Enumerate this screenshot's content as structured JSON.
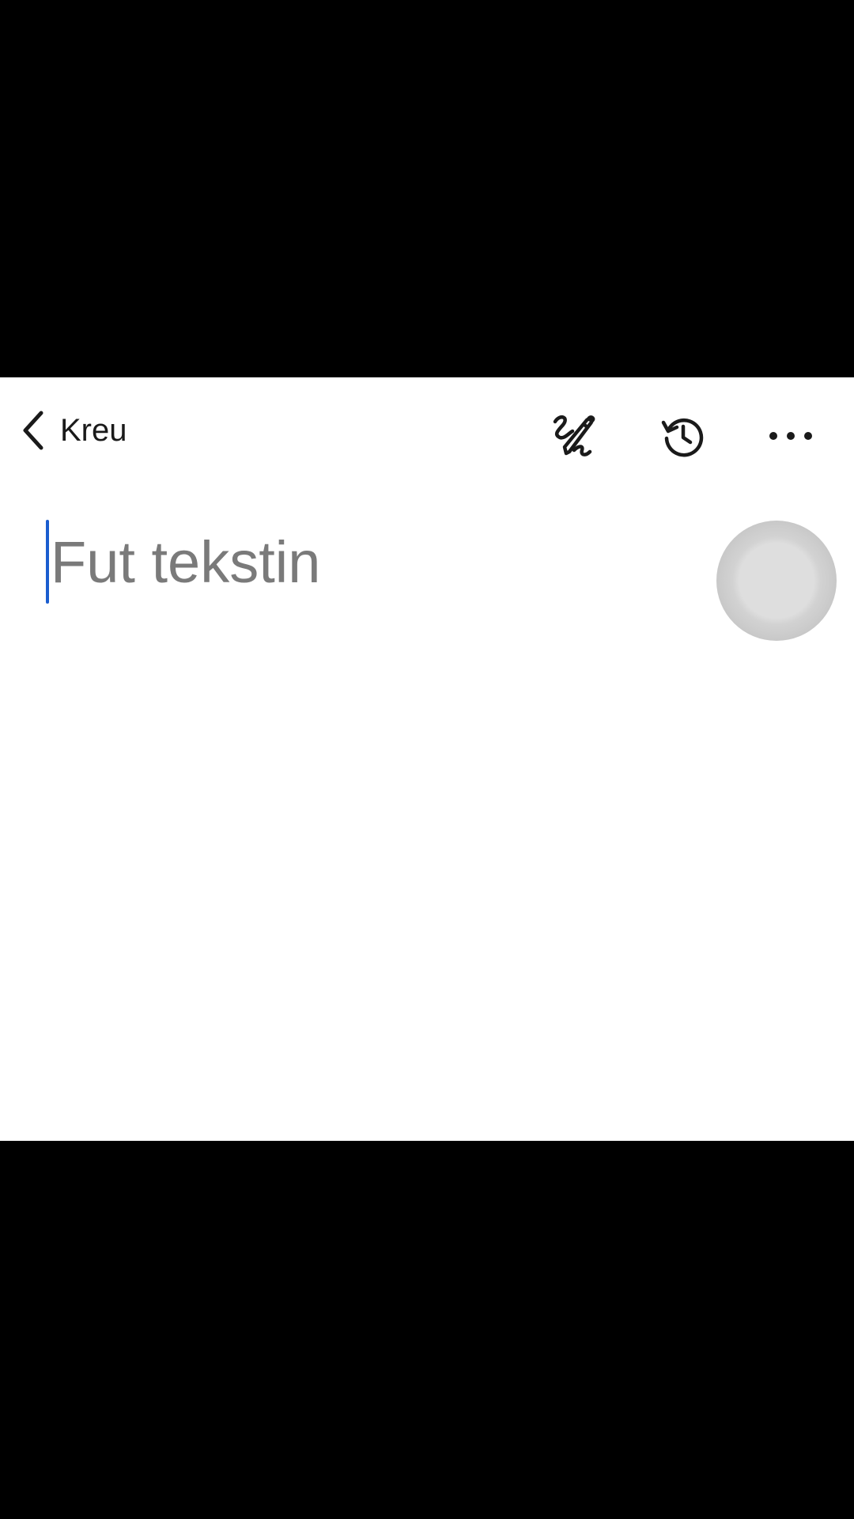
{
  "toolbar": {
    "back_label": "Kreu",
    "icons": {
      "back": "chevron-left-icon",
      "handwriting": "pen-handwriting-icon",
      "history": "history-icon",
      "more": "more-horizontal-icon"
    }
  },
  "editor": {
    "placeholder": "Fut tekstin",
    "value": ""
  },
  "colors": {
    "caret": "#1a5dcf",
    "placeholder": "#7a7a7a",
    "icon": "#1a1a1a",
    "letterbox": "#000000",
    "background": "#ffffff"
  }
}
